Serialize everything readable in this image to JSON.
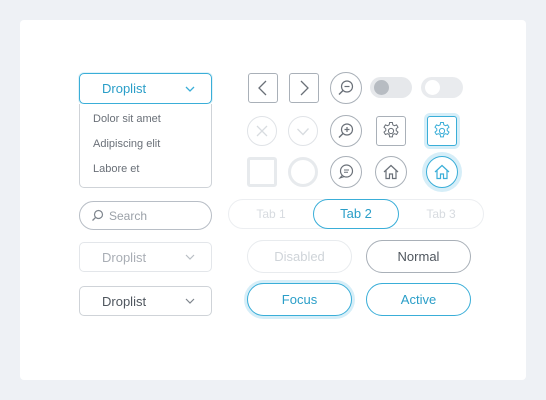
{
  "dropdown_open": {
    "label": "Droplist",
    "options": [
      "Dolor sit amet",
      "Adipiscing elit",
      "Labore et"
    ]
  },
  "search": {
    "placeholder": "Search"
  },
  "dropdown_disabled": {
    "label": "Droplist"
  },
  "dropdown_normal": {
    "label": "Droplist"
  },
  "tabs": [
    "Tab 1",
    "Tab 2",
    "Tab 3"
  ],
  "selected_tab": "Tab 2",
  "buttons": {
    "disabled": "Disabled",
    "normal": "Normal",
    "focus": "Focus",
    "active": "Active"
  },
  "toggles": [
    {
      "state": "off",
      "disabled": true
    },
    {
      "state": "off",
      "disabled": false
    }
  ],
  "icons": [
    "chevron-left",
    "chevron-right",
    "chat",
    "zoom-in",
    "gear",
    "close",
    "check",
    "home"
  ],
  "colors": {
    "accent": "#3aaed8",
    "accent_glow": "#d6eef8",
    "border": "#a9b0b8",
    "text": "#6a7078",
    "background": "#eef1f5"
  }
}
